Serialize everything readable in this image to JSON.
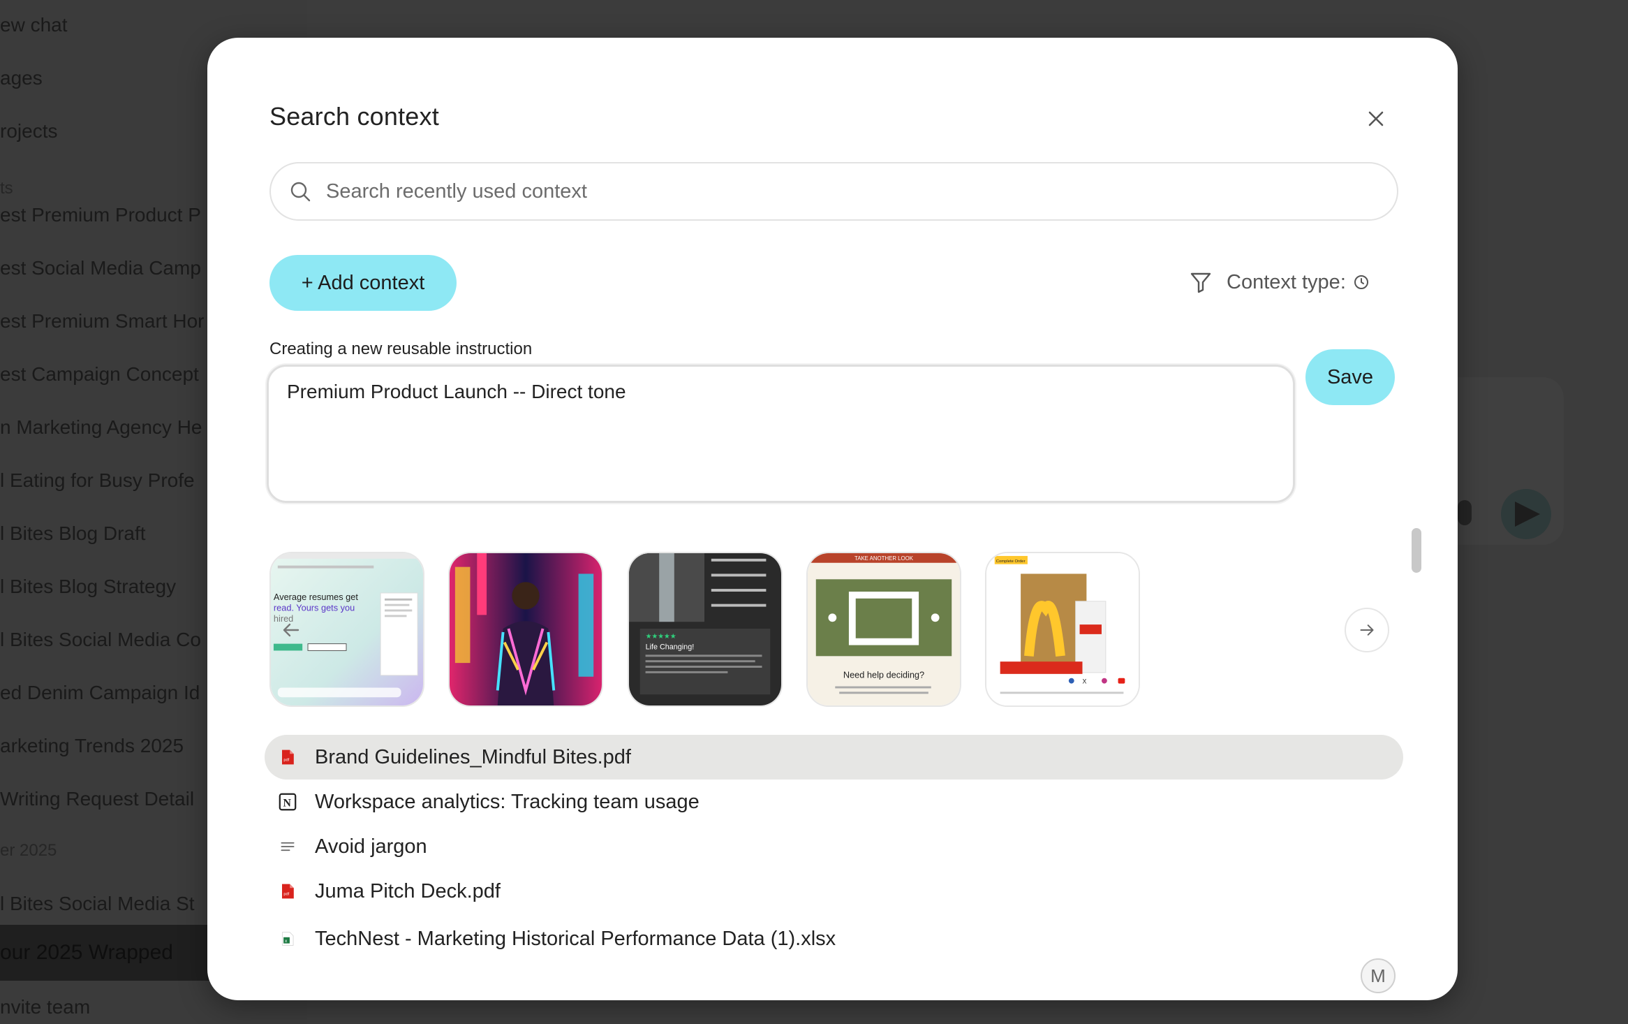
{
  "background": {
    "sidebar_items": [
      {
        "label": "ew chat"
      },
      {
        "label": "ages"
      },
      {
        "label": "rojects"
      },
      {
        "label": "ts",
        "section": true
      },
      {
        "label": "est Premium Product P"
      },
      {
        "label": "est Social Media Camp"
      },
      {
        "label": "est Premium Smart Hor"
      },
      {
        "label": "est Campaign Concept"
      },
      {
        "label": "n Marketing Agency He"
      },
      {
        "label": "l Eating for Busy Profe"
      },
      {
        "label": "l Bites Blog Draft"
      },
      {
        "label": "l Bites Blog Strategy"
      },
      {
        "label": "l Bites Social Media Co"
      },
      {
        "label": "ed Denim Campaign Id"
      },
      {
        "label": "arketing Trends 2025"
      },
      {
        "label": "Writing Request Detail"
      },
      {
        "label": "er 2025",
        "section": true
      },
      {
        "label": "l Bites Social Media St"
      },
      {
        "label": "our 2025 Wrapped",
        "active": true
      },
      {
        "label": "nvite team"
      }
    ]
  },
  "modal": {
    "title": "Search context",
    "close_icon": "close-icon",
    "search": {
      "placeholder": "Search recently used context",
      "value": ""
    },
    "add_context_label": "+ Add context",
    "context_type_label": "Context type:",
    "instruction_label": "Creating a new reusable instruction",
    "instruction_value": "Premium Product Launch -- Direct tone",
    "save_label": "Save",
    "thumbnails": [
      {
        "name": "resume-template-thumbnail",
        "text_1": "Average resumes get",
        "text_2": "read. Yours gets you",
        "text_3": "hired"
      },
      {
        "name": "neon-fashion-thumbnail"
      },
      {
        "name": "supplement-product-thumbnail",
        "text_1": "Life Changing!"
      },
      {
        "name": "rug-shop-thumbnail",
        "text_1": "TAKE ANOTHER LOOK",
        "text_2": "Need help deciding?"
      },
      {
        "name": "mcdonalds-email-thumbnail",
        "text_1": "Complete Order"
      }
    ],
    "context_items": [
      {
        "label": "Brand Guidelines_Mindful Bites.pdf",
        "icon": "pdf-icon",
        "selected": true
      },
      {
        "label": "Workspace analytics: Tracking team usage",
        "icon": "notion-icon"
      },
      {
        "label": "Avoid jargon",
        "icon": "text-lines-icon"
      },
      {
        "label": "Juma Pitch Deck.pdf",
        "icon": "pdf-icon"
      },
      {
        "label": "TechNest - Marketing Historical Performance Data (1).xlsx",
        "icon": "excel-icon"
      }
    ],
    "avatar_initial": "M",
    "colors": {
      "accent": "#8ee8f4",
      "selected_row": "#e6e6e4",
      "pdf_red": "#d9231d",
      "excel_green": "#1d7a43"
    }
  }
}
